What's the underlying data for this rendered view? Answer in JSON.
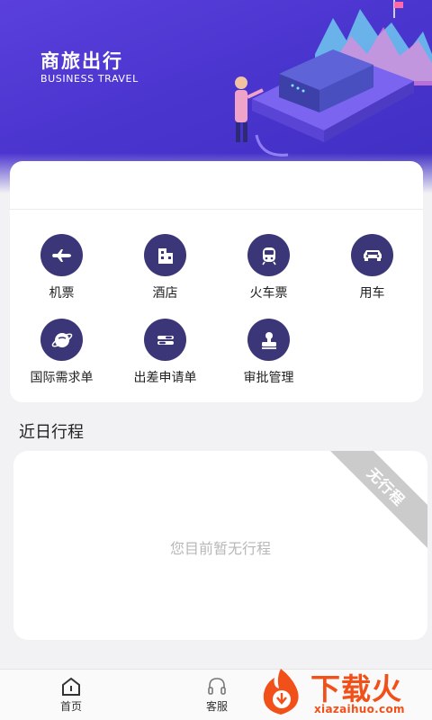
{
  "hero": {
    "title": "商旅出行",
    "subtitle": "BUSINESS TRAVEL"
  },
  "menu": {
    "items": [
      {
        "label": "机票",
        "icon": "airplane-icon"
      },
      {
        "label": "酒店",
        "icon": "hotel-icon"
      },
      {
        "label": "火车票",
        "icon": "train-icon"
      },
      {
        "label": "用车",
        "icon": "car-icon"
      },
      {
        "label": "国际需求单",
        "icon": "globe-icon"
      },
      {
        "label": "出差申请单",
        "icon": "request-form-icon"
      },
      {
        "label": "审批管理",
        "icon": "approval-stamp-icon"
      }
    ]
  },
  "trips": {
    "section_title": "近日行程",
    "ribbon_label": "无行程",
    "empty_message": "您目前暂无行程"
  },
  "tabbar": {
    "tabs": [
      {
        "label": "首页",
        "icon": "home-icon"
      },
      {
        "label": "客服",
        "icon": "headset-icon"
      }
    ]
  },
  "watermark": {
    "text": "下载火",
    "url": "xiazaihuo.com"
  },
  "colors": {
    "hero_bg": "#4b35cf",
    "icon_bg": "#3b3677",
    "page_bg": "#f2f2f4",
    "watermark": "#f25019"
  }
}
